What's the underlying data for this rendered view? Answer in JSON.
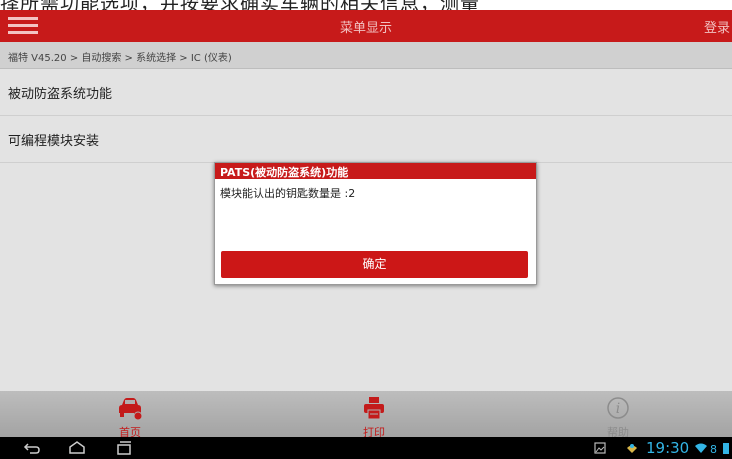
{
  "top_strip": {
    "text": "择所需功能选项，并按要求确实车辆的相关信息，测量"
  },
  "header": {
    "title": "菜单显示",
    "login_label": "登录"
  },
  "breadcrumb": {
    "path": "福特 V45.20 > 自动搜索 > 系统选择 > IC (仪表)"
  },
  "menu": {
    "items": [
      {
        "label": "被动防盗系统功能"
      },
      {
        "label": "可编程模块安装"
      }
    ]
  },
  "dialog": {
    "title": "PATS(被动防盗系统)功能",
    "message": "模块能认出的钥匙数量是 :2",
    "ok_label": "确定"
  },
  "bottom_nav": {
    "items": [
      {
        "label": "首页",
        "icon": "car-icon",
        "color": "#c31b1b"
      },
      {
        "label": "打印",
        "icon": "printer-icon",
        "color": "#c31b1b"
      },
      {
        "label": "帮助",
        "icon": "info-icon",
        "color": "#8c8c8c"
      }
    ]
  },
  "system_bar": {
    "time": "19:30",
    "icons": [
      "back-icon",
      "home-icon",
      "recent-apps-icon",
      "screenshot-icon",
      "notification-icon",
      "wifi-icon",
      "battery-icon"
    ]
  },
  "colors": {
    "accent": "#c71a1a",
    "content_bg": "#e3e3e3",
    "clock": "#33b5e5"
  }
}
